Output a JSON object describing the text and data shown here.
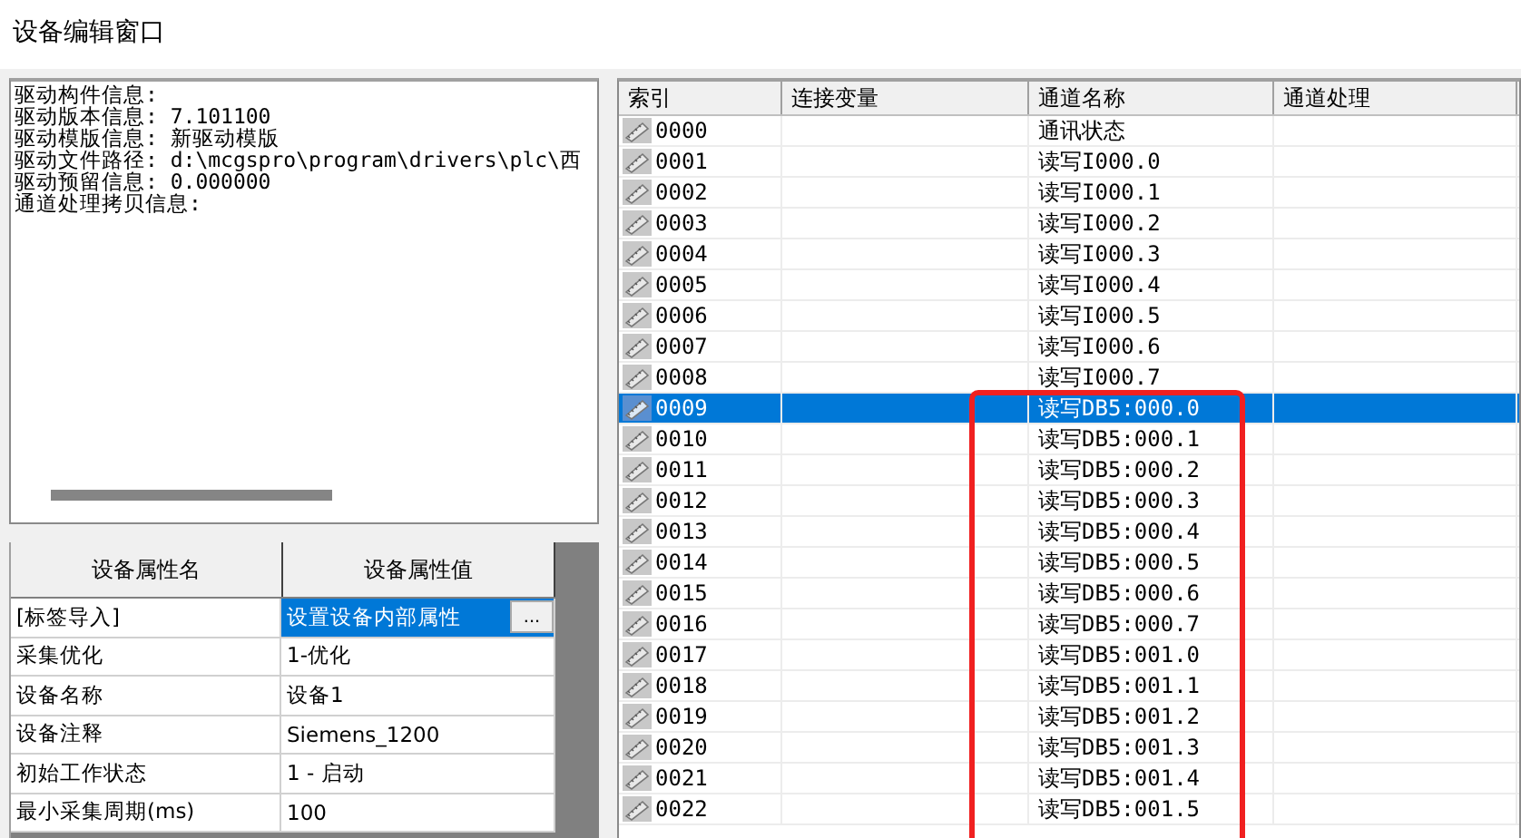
{
  "window": {
    "title": "设备编辑窗口"
  },
  "info_lines": [
    "驱动构件信息:",
    "驱动版本信息: 7.101100",
    "驱动模版信息: 新驱动模版",
    "驱动文件路径: d:\\mcgspro\\program\\drivers\\plc\\西",
    "驱动预留信息: 0.000000",
    "通道处理拷贝信息:"
  ],
  "properties": {
    "columns": [
      "设备属性名",
      "设备属性值"
    ],
    "rows": [
      {
        "name": "[标签导入]",
        "value": "设置设备内部属性",
        "selected": true,
        "button": "..."
      },
      {
        "name": "采集优化",
        "value": "1-优化",
        "selected": false
      },
      {
        "name": "设备名称",
        "value": "设备1",
        "selected": false
      },
      {
        "name": "设备注释",
        "value": "Siemens_1200",
        "selected": false
      },
      {
        "name": "初始工作状态",
        "value": "1 - 启动",
        "selected": false
      },
      {
        "name": "最小采集周期(ms)",
        "value": "100",
        "selected": false
      }
    ]
  },
  "channels": {
    "columns": [
      "索引",
      "连接变量",
      "通道名称",
      "通道处理"
    ],
    "rows": [
      {
        "index": "0000",
        "name": "通讯状态",
        "selected": false
      },
      {
        "index": "0001",
        "name": "读写I000.0",
        "selected": false
      },
      {
        "index": "0002",
        "name": "读写I000.1",
        "selected": false
      },
      {
        "index": "0003",
        "name": "读写I000.2",
        "selected": false
      },
      {
        "index": "0004",
        "name": "读写I000.3",
        "selected": false
      },
      {
        "index": "0005",
        "name": "读写I000.4",
        "selected": false
      },
      {
        "index": "0006",
        "name": "读写I000.5",
        "selected": false
      },
      {
        "index": "0007",
        "name": "读写I000.6",
        "selected": false
      },
      {
        "index": "0008",
        "name": "读写I000.7",
        "selected": false
      },
      {
        "index": "0009",
        "name": "读写DB5:000.0",
        "selected": true
      },
      {
        "index": "0010",
        "name": "读写DB5:000.1",
        "selected": false
      },
      {
        "index": "0011",
        "name": "读写DB5:000.2",
        "selected": false
      },
      {
        "index": "0012",
        "name": "读写DB5:000.3",
        "selected": false
      },
      {
        "index": "0013",
        "name": "读写DB5:000.4",
        "selected": false
      },
      {
        "index": "0014",
        "name": "读写DB5:000.5",
        "selected": false
      },
      {
        "index": "0015",
        "name": "读写DB5:000.6",
        "selected": false
      },
      {
        "index": "0016",
        "name": "读写DB5:000.7",
        "selected": false
      },
      {
        "index": "0017",
        "name": "读写DB5:001.0",
        "selected": false
      },
      {
        "index": "0018",
        "name": "读写DB5:001.1",
        "selected": false
      },
      {
        "index": "0019",
        "name": "读写DB5:001.2",
        "selected": false
      },
      {
        "index": "0020",
        "name": "读写DB5:001.3",
        "selected": false
      },
      {
        "index": "0021",
        "name": "读写DB5:001.4",
        "selected": false
      },
      {
        "index": "0022",
        "name": "读写DB5:001.5",
        "selected": false
      }
    ]
  }
}
